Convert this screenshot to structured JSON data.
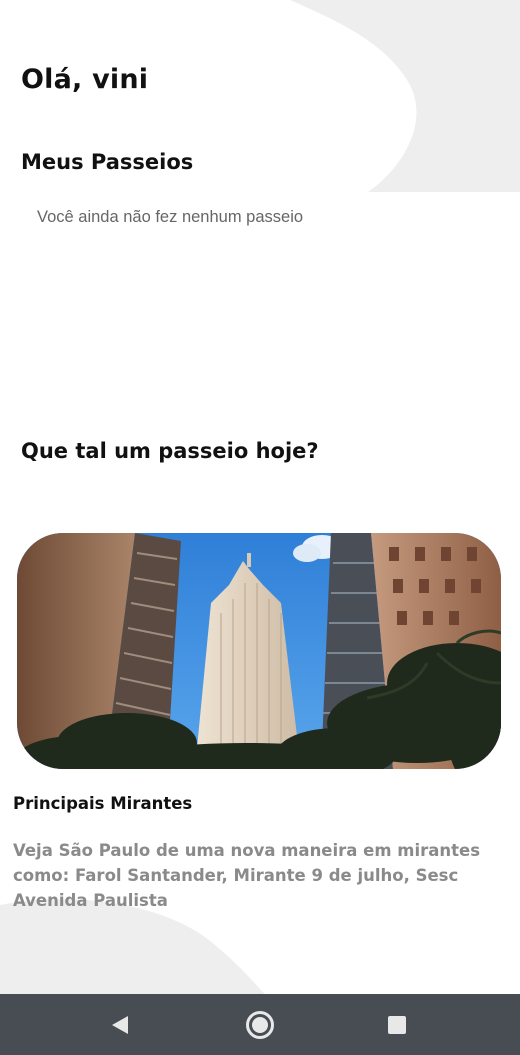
{
  "greeting": "Olá, vini",
  "my_trips": {
    "title": "Meus Passeios",
    "empty_message": "Você ainda não fez nenhum passeio"
  },
  "suggestion": {
    "title": "Que tal um passeio hoje?",
    "card": {
      "image_icon": "city-skyline-photo",
      "title": "Principais Mirantes",
      "description": "Veja São Paulo de uma nova maneira em mirantes como: Farol Santander, Mirante 9 de julho, Sesc Avenida Paulista"
    }
  },
  "navbar": {
    "back_icon": "back-triangle-icon",
    "home_icon": "home-circle-icon",
    "recent_icon": "recent-apps-square-icon"
  },
  "colors": {
    "background": "#ffffff",
    "decor_shape": "#eeeeee",
    "heading_text": "#111111",
    "muted_text": "#8a8a8a",
    "navbar": "#474d52",
    "nav_icon": "#e8e8e8"
  }
}
